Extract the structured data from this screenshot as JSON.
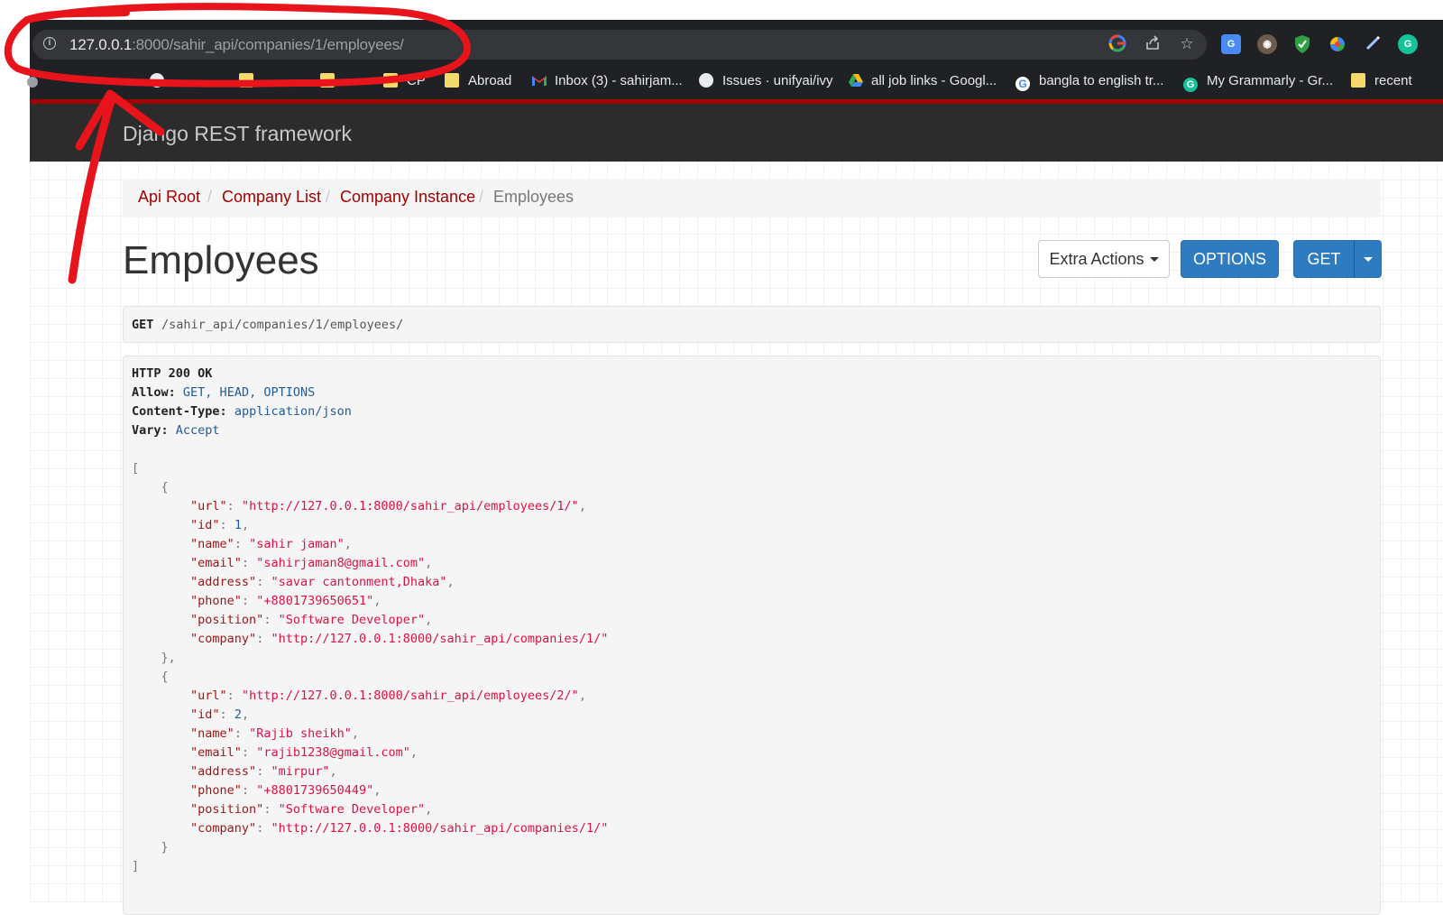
{
  "browser": {
    "url_host": "127.0.0.1",
    "url_rest": ":8000/sahir_api/companies/1/employees/",
    "bookmarks": [
      {
        "label": "CP",
        "icon": "folder-icon"
      },
      {
        "label": "Abroad",
        "icon": "folder-icon"
      },
      {
        "label": "Inbox (3) - sahirjam...",
        "icon": "gmail-icon"
      },
      {
        "label": "Issues · unifyai/ivy",
        "icon": "github-icon"
      },
      {
        "label": "all job links - Googl...",
        "icon": "google-drive-icon"
      },
      {
        "label": "bangla to english tr...",
        "icon": "google-icon"
      },
      {
        "label": "My Grammarly - Gr...",
        "icon": "grammarly-icon"
      },
      {
        "label": "recent",
        "icon": "folder-icon"
      }
    ]
  },
  "drf": {
    "brand": "Django REST framework",
    "breadcrumbs": [
      "Api Root",
      "Company List",
      "Company Instance",
      "Employees"
    ],
    "title": "Employees",
    "buttons": {
      "extra": "Extra Actions",
      "options": "OPTIONS",
      "get": "GET"
    },
    "request": {
      "method": "GET",
      "path": "/sahir_api/companies/1/employees/"
    },
    "response": {
      "status": "HTTP 200 OK",
      "headers": [
        {
          "key": "Allow:",
          "value": "GET, HEAD, OPTIONS"
        },
        {
          "key": "Content-Type:",
          "value": "application/json"
        },
        {
          "key": "Vary:",
          "value": "Accept"
        }
      ],
      "employees": [
        {
          "url": "\"http://127.0.0.1:8000/sahir_api/employees/1/\"",
          "id": "1",
          "name": "\"sahir jaman\"",
          "email": "\"sahirjaman8@gmail.com\"",
          "address": "\"savar cantonment,Dhaka\"",
          "phone": "\"+8801739650651\"",
          "position": "\"Software Developer\"",
          "company": "\"http://127.0.0.1:8000/sahir_api/companies/1/\""
        },
        {
          "url": "\"http://127.0.0.1:8000/sahir_api/employees/2/\"",
          "id": "2",
          "name": "\"Rajib sheikh\"",
          "email": "\"rajib1238@gmail.com\"",
          "address": "\"mirpur\"",
          "phone": "\"+8801739650449\"",
          "position": "\"Software Developer\"",
          "company": "\"http://127.0.0.1:8000/sahir_api/companies/1/\""
        }
      ]
    }
  },
  "colors": {
    "accent": "#a30000",
    "button_primary": "#2f7bbf",
    "annotation": "#e8141c"
  }
}
